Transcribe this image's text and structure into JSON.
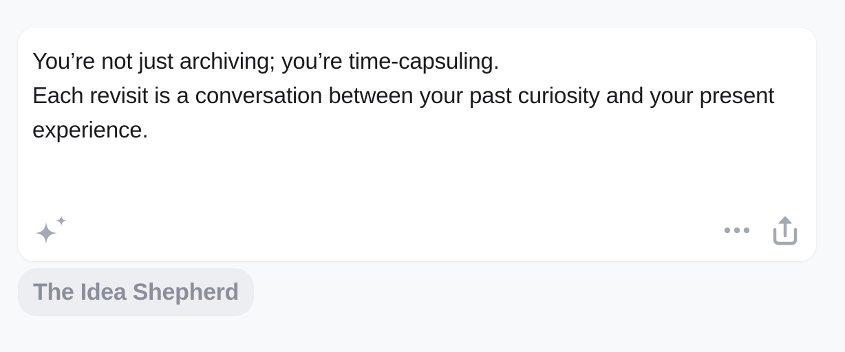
{
  "note": {
    "lines": [
      "You’re not just archiving; you’re time-capsuling.",
      "Each revisit is a conversation between your past curiosity and your present experience."
    ]
  },
  "actions": {
    "sparkle_icon": "sparkle-icon",
    "more_icon": "more-horizontal-icon",
    "share_icon": "share-upload-icon"
  },
  "source": {
    "label": "The Idea Shepherd"
  },
  "colors": {
    "background": "#f8f9fb",
    "card": "#ffffff",
    "text": "#1b1b1f",
    "icon": "#a4a8b2",
    "chip_bg": "#eceef2",
    "chip_text": "#8b8f9a"
  }
}
